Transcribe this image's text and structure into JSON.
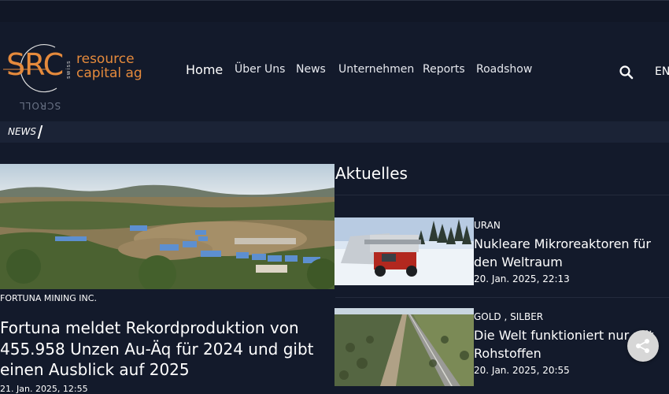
{
  "logo": {
    "mark": "SRC",
    "swiss": "swiss",
    "line1": "resource",
    "line2": "capital ag"
  },
  "scroll_hint": "SCROLL",
  "nav": {
    "items": [
      "Home",
      "Über Uns",
      "News",
      "Unternehmen",
      "Reports",
      "Roadshow"
    ],
    "language": "EN",
    "search_icon": "search-icon"
  },
  "ticker": {
    "label": "NEWS"
  },
  "featured": {
    "category": "FORTUNA MINING INC.",
    "title": "Fortuna meldet Rekordproduktion von 455.958 Unzen Au-Äq für 2024 und gibt einen Ausblick auf 2025",
    "date": "21. Jan. 2025, 12:55"
  },
  "aktuelles": {
    "heading": "Aktuelles",
    "items": [
      {
        "category": "URAN",
        "title": "Nukleare Mikroreaktoren für den Weltraum",
        "date": "20. Jan. 2025, 22:13"
      },
      {
        "category": "GOLD , SILBER",
        "title": "Die Welt funktioniert nur mit Rohstoffen",
        "date": "20. Jan. 2025, 20:55"
      }
    ]
  },
  "share": {
    "icon": "share-icon"
  },
  "colors": {
    "background": "#131a2b",
    "accent": "#e58a3c",
    "ticker_bar": "#1b2336",
    "share_button": "#d7d7d7"
  }
}
